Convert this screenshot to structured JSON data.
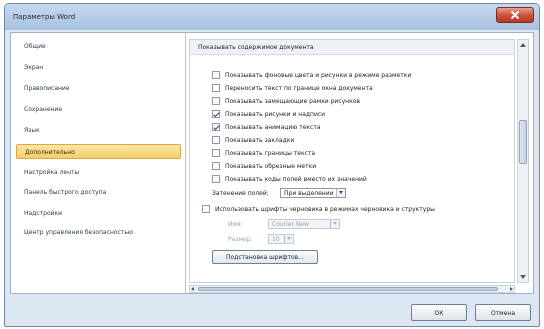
{
  "window": {
    "title": "Параметры Word"
  },
  "sidebar": {
    "items": [
      {
        "label": "Общие",
        "active": false
      },
      {
        "label": "Экран",
        "active": false
      },
      {
        "label": "Правописание",
        "active": false
      },
      {
        "label": "Сохранение",
        "active": false
      },
      {
        "label": "Язык",
        "active": false
      },
      {
        "label": "Дополнительно",
        "active": true
      },
      {
        "label": "Настройка ленты",
        "active": false
      },
      {
        "label": "Панель быстрого доступа",
        "active": false
      },
      {
        "label": "Надстройки",
        "active": false
      },
      {
        "label": "Центр управления безопасностью",
        "active": false
      }
    ]
  },
  "main": {
    "section_title": "Показывать содержимое документа",
    "options": [
      {
        "label": "Показывать фоновые цвета и рисунки в режиме разметки",
        "checked": false
      },
      {
        "label": "Переносить текст по границе окна документа",
        "checked": false
      },
      {
        "label": "Показывать замещающие рамки рисунков",
        "checked": false
      },
      {
        "label": "Показывать рисунки и надписи",
        "checked": true
      },
      {
        "label": "Показывать анимацию текста",
        "checked": true
      },
      {
        "label": "Показывать закладки",
        "checked": false
      },
      {
        "label": "Показывать границы текста",
        "checked": false
      },
      {
        "label": "Показывать обрезные метки",
        "checked": false
      },
      {
        "label": "Показывать коды полей вместо их значений",
        "checked": false
      }
    ],
    "field_shading": {
      "label": "Затенение полей:",
      "value": "При выделении"
    },
    "draft_font": {
      "label": "Использовать шрифты черновика в режимах черновика и структуры",
      "checked": false,
      "name_label": "Имя:",
      "name_value": "Courier New",
      "size_label": "Размер:",
      "size_value": "10"
    },
    "font_substitution_button": "Подстановка шрифтов..."
  },
  "footer": {
    "ok_label": "ОК",
    "cancel_label": "Отмена"
  },
  "colors": {
    "accent_active": "#f7cc6c",
    "title_bar": "#a8c1e0",
    "close_button": "#c8503a"
  }
}
